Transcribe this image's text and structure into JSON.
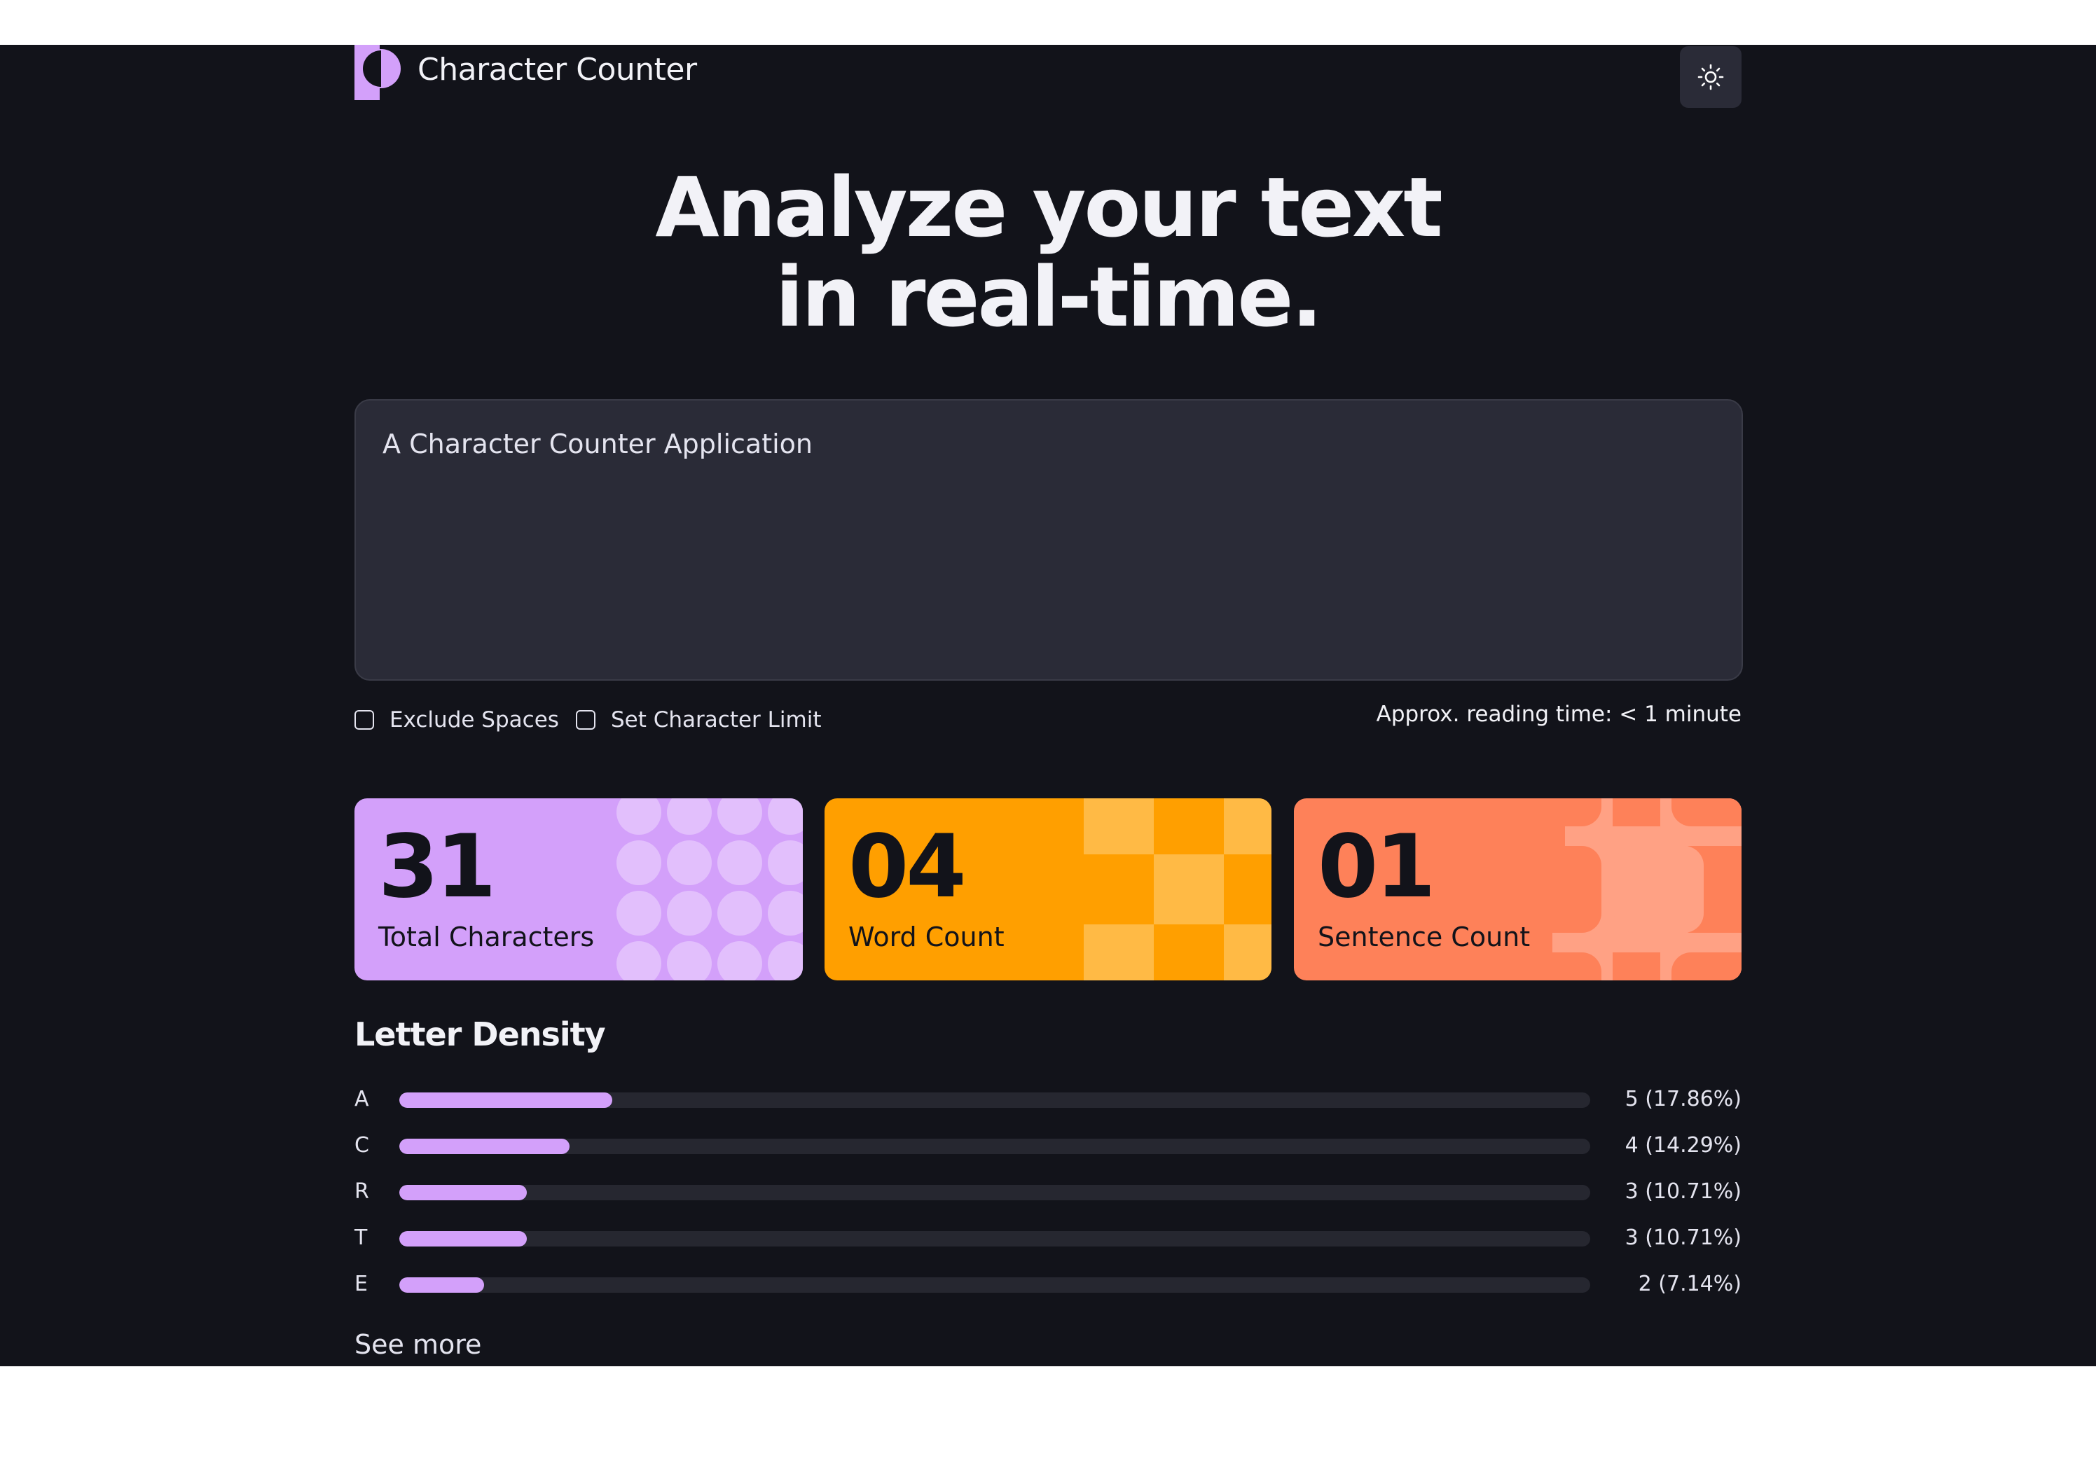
{
  "header": {
    "app_title": "Character Counter",
    "theme_toggle_icon": "sun-icon"
  },
  "hero": {
    "line1": "Analyze your text",
    "line2": "in real-time."
  },
  "editor": {
    "value": "A Character Counter Application"
  },
  "options": {
    "exclude_spaces_label": "Exclude Spaces",
    "exclude_spaces_checked": false,
    "character_limit_label": "Set Character Limit",
    "character_limit_checked": false,
    "reading_time": "Approx. reading time: < 1 minute"
  },
  "stats": [
    {
      "value": "31",
      "label": "Total Characters",
      "color": "#d3a0fa"
    },
    {
      "value": "04",
      "label": "Word Count",
      "color": "#ff9f00"
    },
    {
      "value": "01",
      "label": "Sentence Count",
      "color": "#fe8159"
    }
  ],
  "density": {
    "title": "Letter Density",
    "rows": [
      {
        "letter": "A",
        "value": "5 (17.86%)",
        "percent": 17.86
      },
      {
        "letter": "C",
        "value": "4 (14.29%)",
        "percent": 14.29
      },
      {
        "letter": "R",
        "value": "3 (10.71%)",
        "percent": 10.71
      },
      {
        "letter": "T",
        "value": "3 (10.71%)",
        "percent": 10.71
      },
      {
        "letter": "E",
        "value": "2 (7.14%)",
        "percent": 7.14
      }
    ],
    "see_more": "See more"
  },
  "colors": {
    "background": "#12131a",
    "surface": "#2a2b37",
    "accent": "#d3a0fa",
    "text": "#f2f2f7"
  }
}
